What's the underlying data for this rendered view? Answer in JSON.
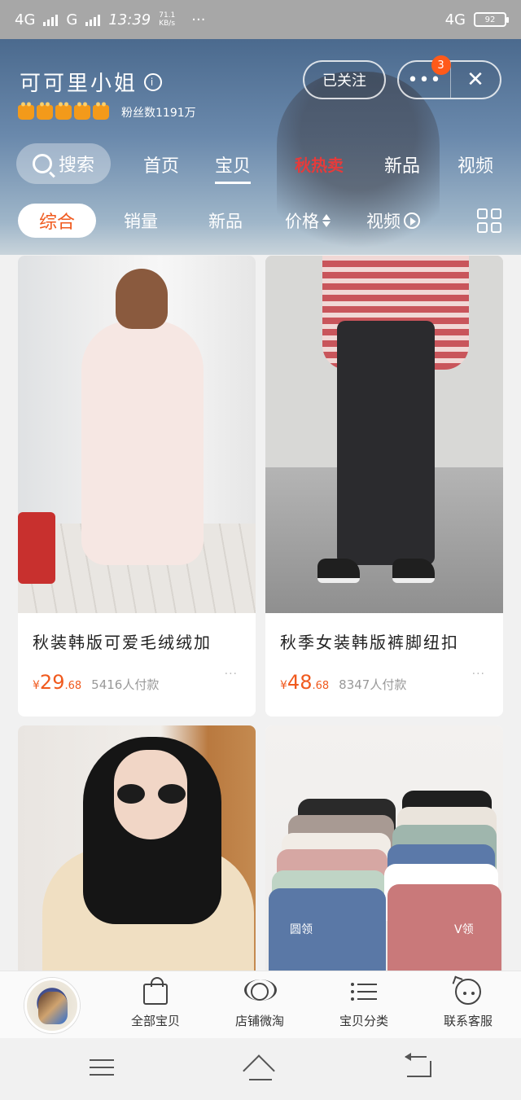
{
  "status_bar": {
    "network_left": "4G",
    "network_left2": "G",
    "time": "13:39",
    "speed": "71.1",
    "speed_unit": "KB/s",
    "dots": "···",
    "network_right": "4G",
    "battery": "92"
  },
  "shop": {
    "name": "可可里小姐",
    "info_icon": "i",
    "fans": "粉丝数1191万",
    "crown_count": 5,
    "follow_label": "已关注",
    "more_label": "•••",
    "more_badge": "3",
    "close_label": "✕"
  },
  "nav": {
    "search_label": "搜索",
    "items": [
      {
        "label": "首页"
      },
      {
        "label": "宝贝"
      },
      {
        "label": "秋热卖"
      },
      {
        "label": "新品"
      },
      {
        "label": "视频"
      }
    ],
    "active": "宝贝"
  },
  "sort": {
    "items": [
      {
        "label": "综合"
      },
      {
        "label": "销量"
      },
      {
        "label": "新品"
      },
      {
        "label": "价格"
      },
      {
        "label": "视频"
      }
    ],
    "active": "综合"
  },
  "products": [
    {
      "title": "秋装韩版可爱毛绒绒加",
      "currency": "¥",
      "price_int": "29",
      "price_dec": ".68",
      "sold": "5416人付款",
      "more": "···"
    },
    {
      "title": "秋季女装韩版裤脚纽扣",
      "currency": "¥",
      "price_int": "48",
      "price_dec": ".68",
      "sold": "8347人付款",
      "more": "···"
    },
    {
      "title": "",
      "currency": "",
      "price_int": "",
      "price_dec": "",
      "sold": "",
      "more": ""
    },
    {
      "title": "",
      "currency": "",
      "price_int": "",
      "price_dec": "",
      "sold": "",
      "more": "",
      "image_text_left": "圆领",
      "image_text_right": "V领"
    }
  ],
  "tabbar": {
    "items": [
      {
        "label": "全部宝贝",
        "icon": "shopping-bag-icon"
      },
      {
        "label": "店铺微淘",
        "icon": "broadcast-icon"
      },
      {
        "label": "宝贝分类",
        "icon": "list-icon"
      },
      {
        "label": "联系客服",
        "icon": "customer-service-icon"
      }
    ]
  },
  "colors": {
    "accent": "#f05a1e",
    "hot": "#e63b3b",
    "header_top": "#4b6a8e"
  }
}
